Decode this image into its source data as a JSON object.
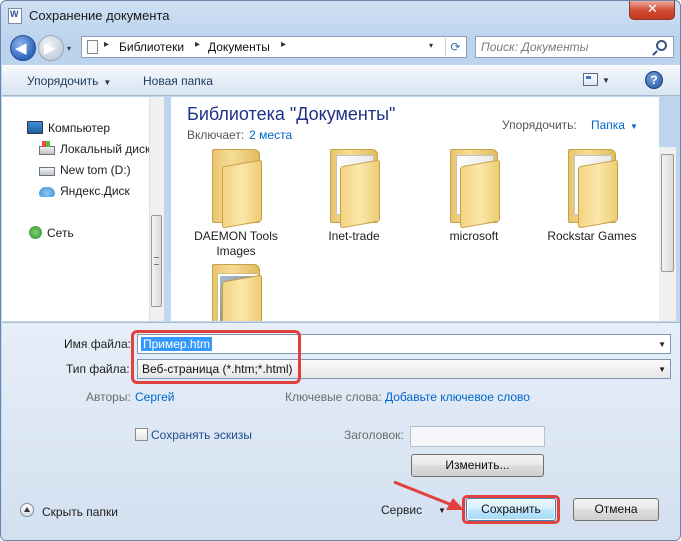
{
  "window": {
    "title": "Сохранение документа",
    "close_symbol": "✕"
  },
  "nav": {
    "back_symbol": "◀",
    "forward_symbol": "▶",
    "dropdown_symbol": "▾"
  },
  "address": {
    "crumbs": [
      "Библиотеки",
      "Документы"
    ],
    "separator": "▸",
    "dropdown_symbol": "▾",
    "refresh_symbol": "⟳"
  },
  "search": {
    "placeholder": "Поиск: Документы"
  },
  "toolbar": {
    "organize_label": "Упорядочить",
    "organize_arrow": "▼",
    "new_folder_label": "Новая папка",
    "view_dropdown": "▼",
    "help_symbol": "?"
  },
  "sidebar": {
    "items": [
      {
        "label": "Компьютер",
        "icon": "computer-icon"
      },
      {
        "label": "Локальный диск",
        "icon": "system-disk-icon"
      },
      {
        "label": "New tom (D:)",
        "icon": "disk-icon"
      },
      {
        "label": "Яндекс.Диск",
        "icon": "cloud-icon"
      },
      {
        "label": "Сеть",
        "icon": "network-icon"
      }
    ]
  },
  "library": {
    "title": "Библиотека \"Документы\"",
    "includes_label": "Включает:",
    "includes_link": "2 места",
    "arrange_label": "Упорядочить:",
    "arrange_value": "Папка",
    "arrange_arrow": "▼"
  },
  "folders": [
    {
      "name": "DAEMON Tools Images",
      "icon": "folder-icon"
    },
    {
      "name": "Inet-trade",
      "icon": "folder-documents-icon"
    },
    {
      "name": "microsoft",
      "icon": "folder-documents-icon"
    },
    {
      "name": "Rockstar Games",
      "icon": "folder-documents-icon"
    },
    {
      "name": "",
      "icon": "folder-pictures-icon"
    }
  ],
  "form": {
    "filename_label": "Имя файла:",
    "filename_value": "Пример.htm",
    "filetype_label": "Тип файла:",
    "filetype_value": "Веб-страница (*.htm;*.html)",
    "dropdown_symbol": "▼",
    "authors_label": "Авторы:",
    "authors_value": "Сергей",
    "keywords_label": "Ключевые слова:",
    "keywords_value": "Добавьте ключевое слово",
    "thumbnails_label": "Сохранять эскизы",
    "heading_label": "Заголовок:",
    "change_button": "Изменить...",
    "hide_folders_label": "Скрыть папки",
    "service_label": "Сервис",
    "service_arrow": "▼",
    "save_button": "Сохранить",
    "cancel_button": "Отмена"
  },
  "colors": {
    "highlight": "#e2403d",
    "link": "#0066cc",
    "library_title": "#1e3287"
  }
}
